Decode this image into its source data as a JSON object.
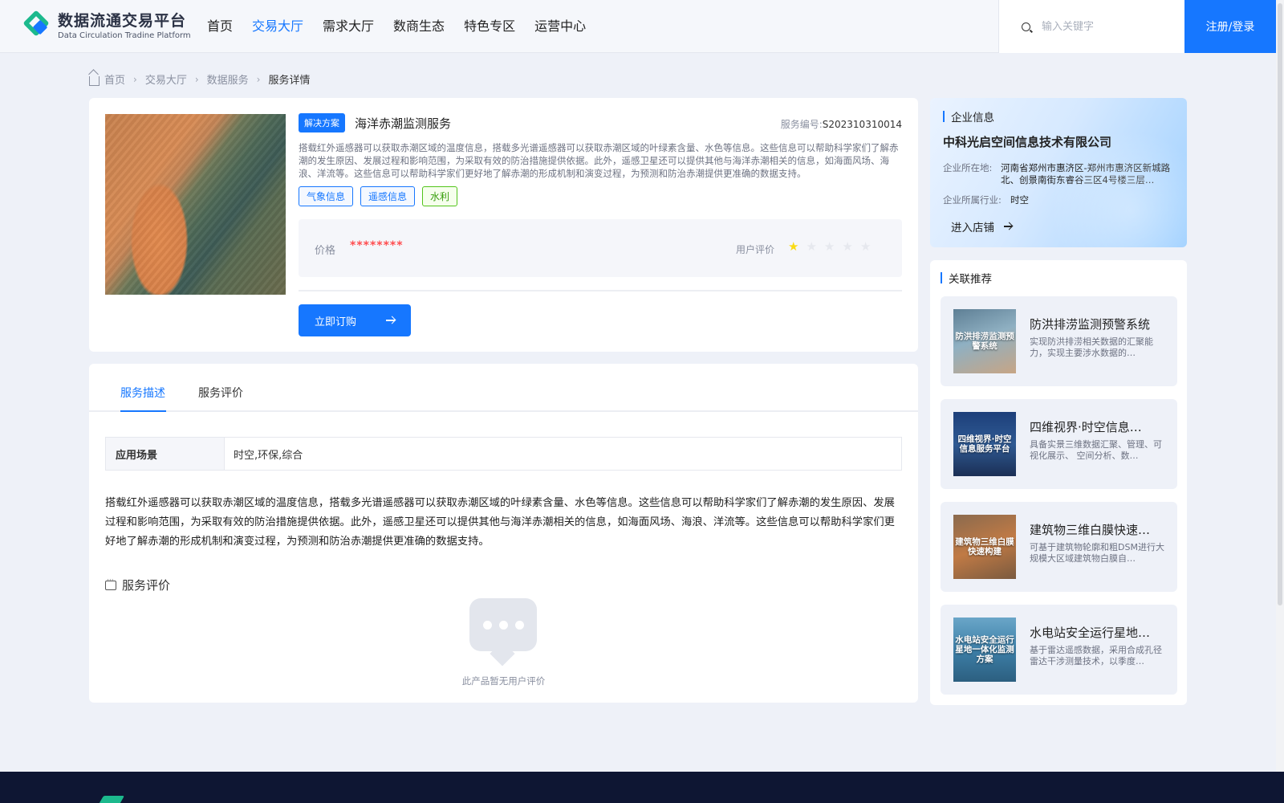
{
  "header": {
    "logo_cn": "数据流通交易平台",
    "logo_en": "Data Circulation Tradine Platform",
    "nav": [
      {
        "label": "首页",
        "active": false
      },
      {
        "label": "交易大厅",
        "active": true
      },
      {
        "label": "需求大厅",
        "active": false
      },
      {
        "label": "数商生态",
        "active": false
      },
      {
        "label": "特色专区",
        "active": false
      },
      {
        "label": "运营中心",
        "active": false
      }
    ],
    "search_placeholder": "输入关键字",
    "login_label": "注册/登录"
  },
  "breadcrumb": [
    "首页",
    "交易大厅",
    "数据服务",
    "服务详情"
  ],
  "service": {
    "badge": "解决方案",
    "title": "海洋赤潮监测服务",
    "number_label": "服务编号:",
    "number": "S202310310014",
    "description": "搭载红外遥感器可以获取赤潮区域的温度信息，搭载多光谱遥感器可以获取赤潮区域的叶绿素含量、水色等信息。这些信息可以帮助科学家们了解赤潮的发生原因、发展过程和影响范围，为采取有效的防治措施提供依据。此外，遥感卫星还可以提供其他与海洋赤潮相关的信息，如海面风场、海浪、洋流等。这些信息可以帮助科学家们更好地了解赤潮的形成机制和演变过程，为预测和防治赤潮提供更准确的数据支持。",
    "tags": [
      "气象信息",
      "遥感信息",
      "水利"
    ],
    "price_label": "价格",
    "price_value": "********",
    "rating_label": "用户评价",
    "rating": 1,
    "rating_max": 5,
    "buy_label": "立即订购"
  },
  "detail": {
    "tabs": [
      "服务描述",
      "服务评价"
    ],
    "active_tab": 0,
    "scene_label": "应用场景",
    "scene_value": "时空,环保,综合",
    "full_description": "搭载红外遥感器可以获取赤潮区域的温度信息，搭载多光谱遥感器可以获取赤潮区域的叶绿素含量、水色等信息。这些信息可以帮助科学家们了解赤潮的发生原因、发展过程和影响范围，为采取有效的防治措施提供依据。此外，遥感卫星还可以提供其他与海洋赤潮相关的信息，如海面风场、海浪、洋流等。这些信息可以帮助科学家们更好地了解赤潮的形成机制和演变过程，为预测和防治赤潮提供更准确的数据支持。",
    "review_title": "服务评价",
    "empty_text": "此产品暂无用户评价"
  },
  "company": {
    "section_title": "企业信息",
    "name": "中科光启空间信息技术有限公司",
    "location_label": "企业所在地:",
    "location": "河南省郑州市惠济区-郑州市惠济区新城路北、创景南街东睿谷三区4号楼三层…",
    "industry_label": "企业所属行业:",
    "industry": "时空",
    "enter_label": "进入店铺"
  },
  "recommend": {
    "section_title": "关联推荐",
    "items": [
      {
        "name": "防洪排涝监测预警系统",
        "desc": "实现防洪排涝相关数据的汇聚能力，实现主要涉水数据的…",
        "thumb_text": "防洪排涝监测预警系统",
        "thumb_color": "#7fa3b8"
      },
      {
        "name": "四维视界·时空信息…",
        "desc": "具备实景三维数据汇聚、管理、可视化展示、 空间分析、数…",
        "thumb_text": "四维视界·时空信息服务平台",
        "thumb_color": "#2a4a7a"
      },
      {
        "name": "建筑物三维白膜快速…",
        "desc": "可基于建筑物轮廓和粗DSM进行大规模大区域建筑物白膜自…",
        "thumb_text": "建筑物三维白膜快速构建",
        "thumb_color": "#b86a3a"
      },
      {
        "name": "水电站安全运行星地…",
        "desc": "基于雷达遥感数据，采用合成孔径雷达干涉测量技术，以季度…",
        "thumb_text": "水电站安全运行星地一体化监测方案",
        "thumb_color": "#3c7fa8"
      }
    ]
  }
}
